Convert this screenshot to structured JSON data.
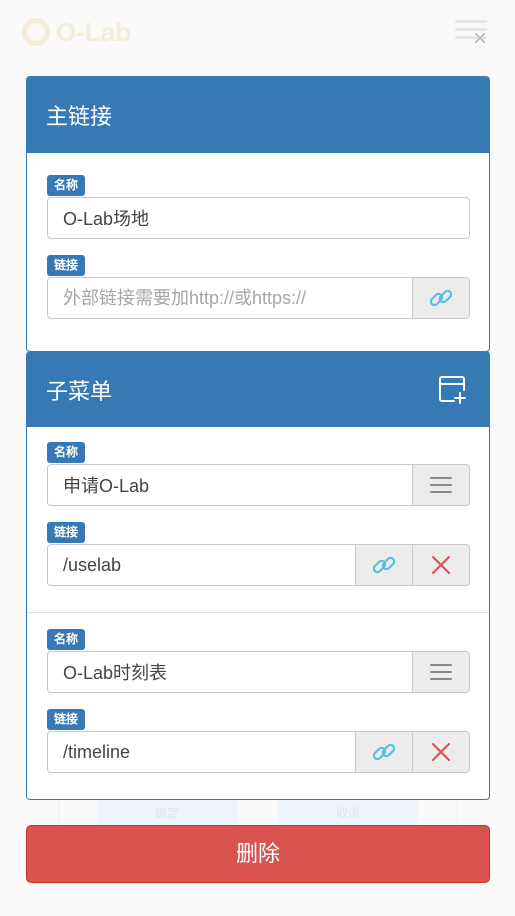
{
  "background": {
    "logo_text": "O-Lab",
    "buttons": [
      "确定",
      "取消"
    ]
  },
  "close_label": "×",
  "main_link": {
    "title": "主链接",
    "name_tag": "名称",
    "name_value": "O-Lab场地",
    "link_tag": "链接",
    "link_value": "",
    "link_placeholder": "外部链接需要加http://或https://"
  },
  "submenu": {
    "title": "子菜单",
    "items": [
      {
        "name_tag": "名称",
        "name_value": "申请O-Lab",
        "link_tag": "链接",
        "link_value": "/uselab"
      },
      {
        "name_tag": "名称",
        "name_value": "O-Lab时刻表",
        "link_tag": "链接",
        "link_value": "/timeline"
      }
    ]
  },
  "delete_label": "删除",
  "colors": {
    "primary": "#3679b5",
    "danger": "#d9534f",
    "link_icon": "#5bc0de",
    "remove_icon": "#d9534f"
  },
  "icons": {
    "add_submenu": "add-submenu-icon",
    "link": "link-icon",
    "menu": "hamburger-icon",
    "remove": "close-icon"
  }
}
